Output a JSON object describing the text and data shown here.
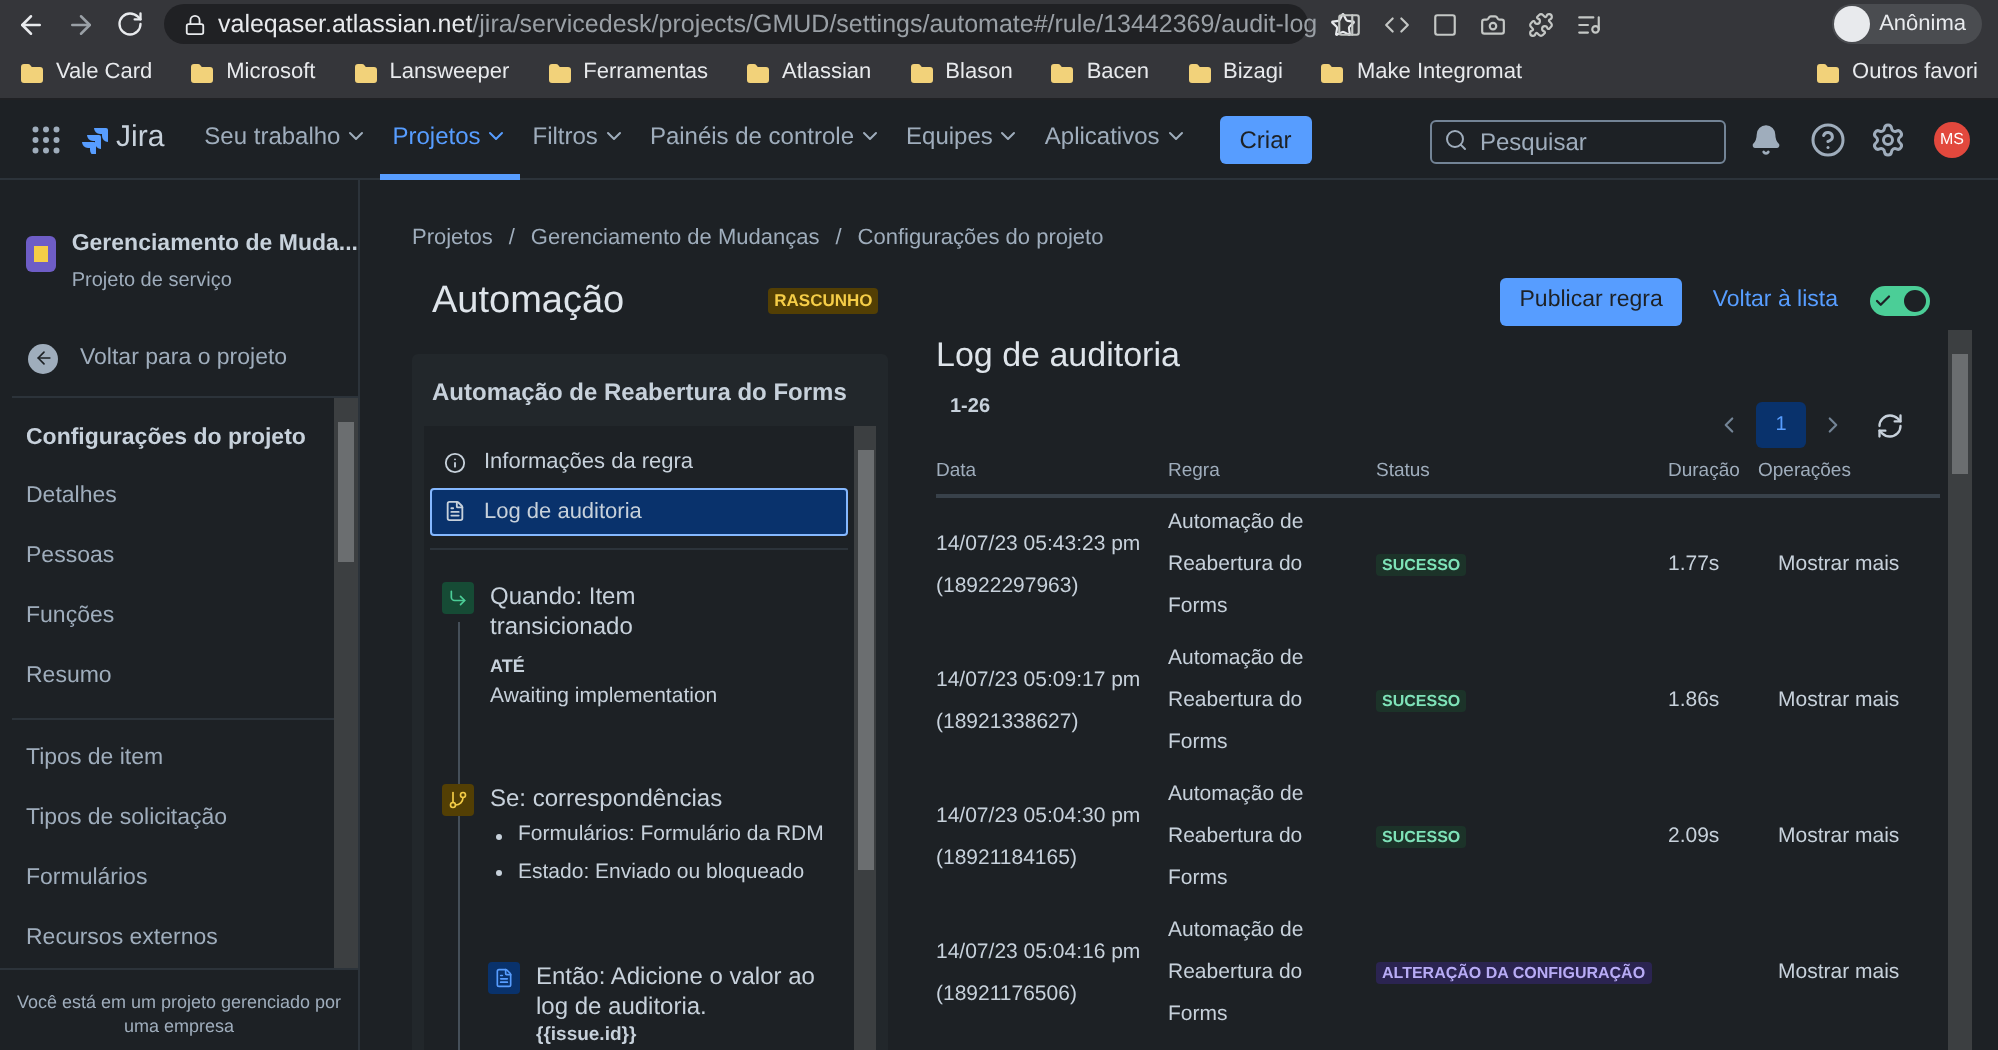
{
  "browser": {
    "url_host": "valeqaser.atlassian.net",
    "url_path": "/jira/servicedesk/projects/GMUD/settings/automate#/rule/13442369/audit-log",
    "profile": "Anônima",
    "bookmarks": [
      "Vale Card",
      "Microsoft",
      "Lansweeper",
      "Ferramentas",
      "Atlassian",
      "Blason",
      "Bacen",
      "Bizagi",
      "Make Integromat"
    ],
    "other_bookmarks": "Outros favori"
  },
  "nav": {
    "product": "Jira",
    "items": [
      {
        "label": "Seu trabalho",
        "selected": false
      },
      {
        "label": "Projetos",
        "selected": true
      },
      {
        "label": "Filtros",
        "selected": false
      },
      {
        "label": "Painéis de controle",
        "selected": false
      },
      {
        "label": "Equipes",
        "selected": false
      },
      {
        "label": "Aplicativos",
        "selected": false
      }
    ],
    "create": "Criar",
    "search": {
      "placeholder": "Pesquisar"
    },
    "avatar": "MS"
  },
  "sidebar": {
    "project_name": "Gerenciamento de Muda...",
    "project_type": "Projeto de serviço",
    "back": "Voltar para o projeto",
    "heading": "Configurações do projeto",
    "groups": [
      [
        "Detalhes",
        "Pessoas",
        "Funções",
        "Resumo"
      ],
      [
        "Tipos de item",
        "Tipos de solicitação",
        "Formulários",
        "Recursos externos"
      ]
    ],
    "footer": "Você está em um projeto gerenciado por uma empresa"
  },
  "breadcrumbs": {
    "separator": "/",
    "items": [
      "Projetos",
      "Gerenciamento de Mudanças",
      "Configurações do projeto"
    ]
  },
  "header": {
    "title": "Automação",
    "badge": "RASCUNHO",
    "publish": "Publicar regra",
    "back_link": "Voltar à lista",
    "enabled": true
  },
  "rule": {
    "title": "Automação de Reabertura do Forms",
    "menu": [
      {
        "label": "Informações da regra",
        "kind": "info",
        "selected": false
      },
      {
        "label": "Log de auditoria",
        "kind": "log",
        "selected": true
      }
    ],
    "steps": [
      {
        "kind": "trigger",
        "title": "Quando: Item transicionado",
        "label": "ATÉ",
        "value": "Awaiting implementation"
      },
      {
        "kind": "condition",
        "title": "Se: correspondências",
        "bullets": [
          "Formulários: Formulário da RDM",
          "Estado: Enviado ou bloqueado"
        ]
      },
      {
        "kind": "action",
        "title": "Então: Adicione o valor ao log de auditoria.",
        "code": "{{issue.id}}"
      }
    ]
  },
  "audit": {
    "title": "Log de auditoria",
    "range": "1-26",
    "pages": [
      {
        "label": "1",
        "selected": true
      }
    ],
    "columns": [
      "Data",
      "Regra",
      "Status",
      "Duração",
      "Operações"
    ],
    "rows": [
      {
        "date": "14/07/23 05:43:23 pm",
        "execution_id": "(18922297963)",
        "rule": "Automação de Reabertura do Forms",
        "status": {
          "kind": "success",
          "label": "SUCESSO"
        },
        "duration": "1.77s",
        "operations": "Mostrar mais"
      },
      {
        "date": "14/07/23 05:09:17 pm",
        "execution_id": "(18921338627)",
        "rule": "Automação de Reabertura do Forms",
        "status": {
          "kind": "success",
          "label": "SUCESSO"
        },
        "duration": "1.86s",
        "operations": "Mostrar mais"
      },
      {
        "date": "14/07/23 05:04:30 pm",
        "execution_id": "(18921184165)",
        "rule": "Automação de Reabertura do Forms",
        "status": {
          "kind": "success",
          "label": "SUCESSO"
        },
        "duration": "2.09s",
        "operations": "Mostrar mais"
      },
      {
        "date": "14/07/23 05:04:16 pm",
        "execution_id": "(18921176506)",
        "rule": "Automação de Reabertura do Forms",
        "status": {
          "kind": "config",
          "label": "ALTERAÇÃO DA CONFIGURAÇÃO"
        },
        "operations": "Mostrar mais"
      }
    ]
  }
}
